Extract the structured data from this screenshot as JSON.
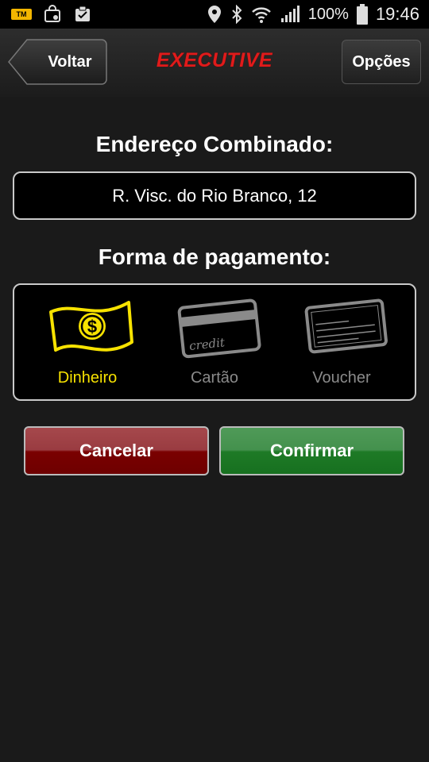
{
  "status_bar": {
    "battery": "100%",
    "time": "19:46",
    "left_icons": [
      "tmhi-icon",
      "shopping-bag-icon",
      "clipboard-check-icon"
    ],
    "right_icons": [
      "location-pin-icon",
      "bluetooth-icon",
      "wifi-icon",
      "signal-icon",
      "battery-icon"
    ]
  },
  "navbar": {
    "back_label": "Voltar",
    "logo_text": "EXECUTIVE",
    "options_label": "Opções"
  },
  "address": {
    "title": "Endereço Combinado:",
    "value": "R. Visc. do Rio Branco, 12"
  },
  "payment": {
    "title": "Forma de pagamento:",
    "options": [
      {
        "label": "Dinheiro",
        "icon": "cash-icon",
        "selected": true
      },
      {
        "label": "Cartão",
        "icon": "credit-card-icon",
        "selected": false
      },
      {
        "label": "Voucher",
        "icon": "voucher-icon",
        "selected": false
      }
    ]
  },
  "actions": {
    "cancel_label": "Cancelar",
    "confirm_label": "Confirmar"
  },
  "colors": {
    "selected": "#f7e200",
    "unselected": "#8a8a8a",
    "logo": "#e01b1b",
    "cancel": "#7a0000",
    "confirm": "#1e7a26"
  }
}
